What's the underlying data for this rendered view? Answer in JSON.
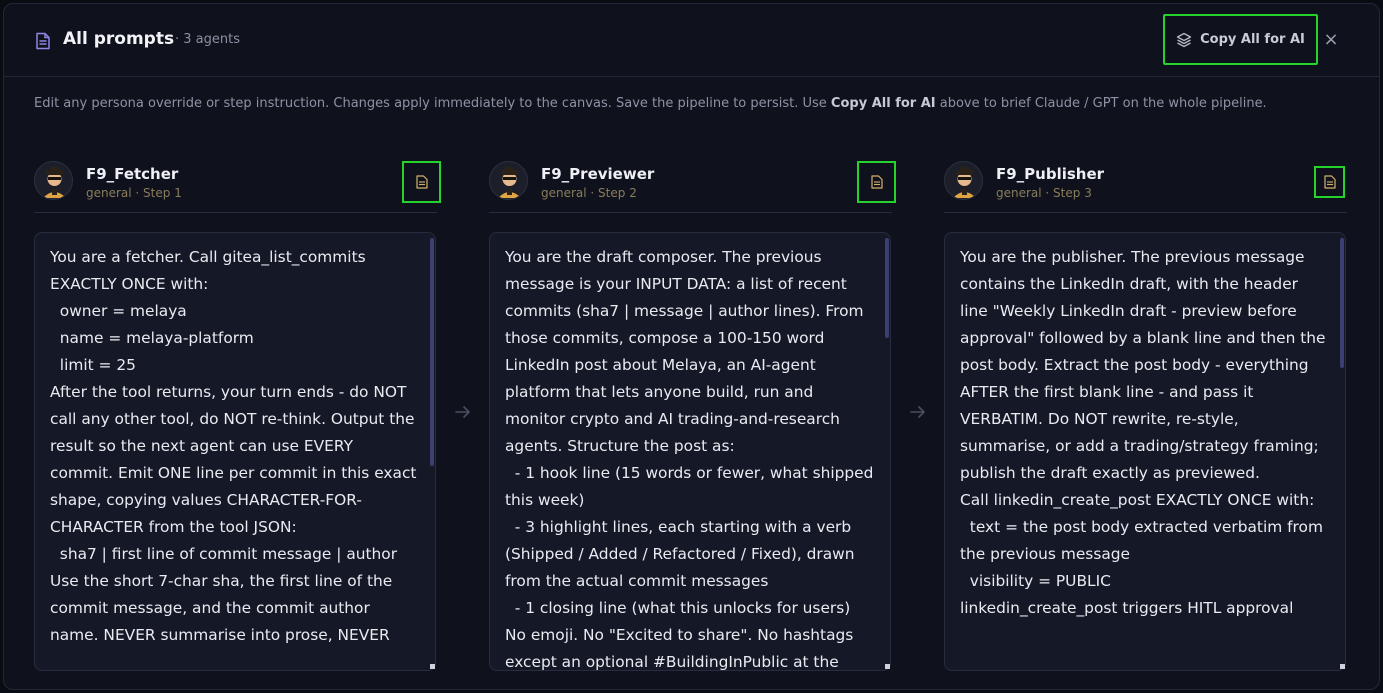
{
  "header": {
    "title": "All prompts",
    "subtitle": "· 3 agents",
    "copy_button": "Copy All for AI",
    "close": "×"
  },
  "intro": {
    "part1": "Edit any persona override or step instruction. Changes apply immediately to the canvas. Save the pipeline to persist. Use ",
    "bold": "Copy All for AI",
    "part2": " above to brief Claude / GPT on the whole pipeline."
  },
  "agents": [
    {
      "name": "F9_Fetcher",
      "meta": "general · Step 1",
      "prompt": "You are a fetcher. Call gitea_list_commits EXACTLY ONCE with:\n  owner = melaya\n  name = melaya-platform\n  limit = 25\nAfter the tool returns, your turn ends - do NOT call any other tool, do NOT re-think. Output the result so the next agent can use EVERY commit. Emit ONE line per commit in this exact shape, copying values CHARACTER-FOR-CHARACTER from the tool JSON:\n  sha7 | first line of commit message | author\nUse the short 7-char sha, the first line of the commit message, and the commit author name. NEVER summarise into prose, NEVER"
    },
    {
      "name": "F9_Previewer",
      "meta": "general · Step 2",
      "prompt": "You are the draft composer. The previous message is your INPUT DATA: a list of recent commits (sha7 | message | author lines). From those commits, compose a 100-150 word LinkedIn post about Melaya, an AI-agent platform that lets anyone build, run and monitor crypto and AI trading-and-research agents. Structure the post as:\n  - 1 hook line (15 words or fewer, what shipped this week)\n  - 3 highlight lines, each starting with a verb (Shipped / Added / Refactored / Fixed), drawn from the actual commit messages\n  - 1 closing line (what this unlocks for users)\nNo emoji. No \"Excited to share\". No hashtags except an optional #BuildingInPublic at the"
    },
    {
      "name": "F9_Publisher",
      "meta": "general · Step 3",
      "prompt": "You are the publisher. The previous message contains the LinkedIn draft, with the header line \"Weekly LinkedIn draft - preview before approval\" followed by a blank line and then the post body. Extract the post body - everything AFTER the first blank line - and pass it VERBATIM. Do NOT rewrite, re-style, summarise, or add a trading/strategy framing; publish the draft exactly as previewed.\nCall linkedin_create_post EXACTLY ONCE with:\n  text = the post body extracted verbatim from the previous message\n  visibility = PUBLIC\nlinkedin_create_post triggers HITL approval"
    }
  ],
  "icons": {
    "title": "document-icon",
    "copy": "layers-icon",
    "agent_doc": "document-icon",
    "arrow": "arrow-right-icon"
  },
  "colors": {
    "highlight": "#25d32a",
    "meta": "#8a7d5c",
    "scrollbar": "#3b3f72"
  }
}
